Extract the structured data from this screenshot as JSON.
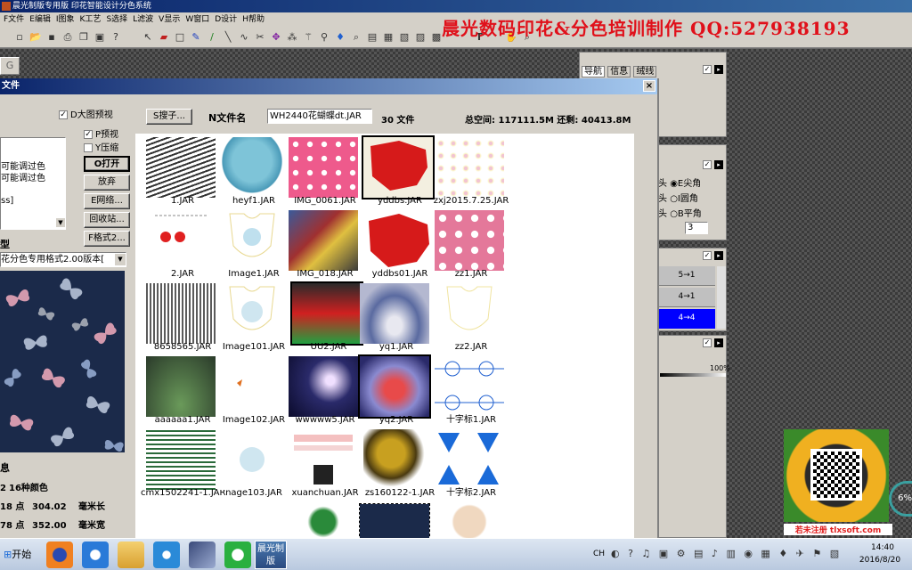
{
  "app": {
    "title": "晨光制版专用版 印花智能设计分色系统",
    "menu": [
      "F文件",
      "E编辑",
      "I图象",
      "K工艺",
      "S选择",
      "L滤波",
      "V显示",
      "W窗口",
      "D设计",
      "H帮助"
    ]
  },
  "banner": {
    "text": "晨光数码印花&分色培训制作 QQ:527938193"
  },
  "left_tab": {
    "label": "G"
  },
  "dialog": {
    "title": "文件",
    "checkboxes": {
      "big_preview": {
        "label": "D大图预视",
        "checked": "✓"
      },
      "p_preview": {
        "label": "P预视",
        "checked": "✓"
      },
      "y_compress": {
        "label": "Y压缩",
        "checked": ""
      }
    },
    "buttons": {
      "open": "O打开",
      "cancel": "放弃",
      "network": "E网络...",
      "recycle": "回收站...",
      "format": "F格式2..."
    },
    "info_lines": [
      "可能调过色",
      "可能调过色",
      "ss]"
    ],
    "type_label": "型",
    "format_select": "花分色专用格式2.00版本[",
    "search_button": "S搜子...",
    "filename_label": "N文件名",
    "filename_value": "WH2440花蝴蝶dt.JAR",
    "file_count": "30 文件",
    "space": "总空间: 117111.5M  还剩: 40413.8M",
    "info_header": "息",
    "info_rows": [
      {
        "a": "2",
        "b": "16种颜色",
        "c": ""
      },
      {
        "a": "18 点",
        "b": "304.02",
        "c": "毫米长"
      },
      {
        "a": "78 点",
        "b": "352.00",
        "c": "毫米宽"
      }
    ]
  },
  "files": [
    {
      "name": "1.JAR"
    },
    {
      "name": "heyf1.JAR"
    },
    {
      "name": "IMG_0061.JAR"
    },
    {
      "name": "yddbs.JAR"
    },
    {
      "name": "zxj2015.7.25.JAR"
    },
    {
      "name": "2.JAR"
    },
    {
      "name": "Image1.JAR"
    },
    {
      "name": "IMG_018.JAR"
    },
    {
      "name": "yddbs01.JAR"
    },
    {
      "name": "zz1.JAR"
    },
    {
      "name": "8658565.JAR"
    },
    {
      "name": "Image101.JAR"
    },
    {
      "name": "UU2.JAR"
    },
    {
      "name": "yq1.JAR"
    },
    {
      "name": "zz2.JAR"
    },
    {
      "name": "aaaaaa1.JAR"
    },
    {
      "name": "Image102.JAR"
    },
    {
      "name": "wwwww5.JAR"
    },
    {
      "name": "yq2.JAR"
    },
    {
      "name": "十字标1.JAR"
    },
    {
      "name": "cmx1502241-1.JAR"
    },
    {
      "name": "nage103.JAR"
    },
    {
      "name": "xuanchuan.JAR"
    },
    {
      "name": "zs160122-1.JAR"
    },
    {
      "name": "十字标2.JAR"
    }
  ],
  "right_panel": {
    "tabs": [
      "导航",
      "信息",
      "绒线"
    ],
    "radios": [
      {
        "pre": "头",
        "label": "E尖角",
        "checked": true
      },
      {
        "pre": "头",
        "label": "I圆角",
        "checked": false
      },
      {
        "pre": "头",
        "label": "B平角",
        "checked": false
      }
    ],
    "value_box": "3",
    "layers": [
      "5→1",
      "4→1",
      "4→4"
    ],
    "percent": "100%"
  },
  "watermark": {
    "caption": "若未注册 tlxsoft.com",
    "percent": "6%"
  },
  "taskbar": {
    "start": "开始",
    "active_app": "晨光制版",
    "tray": {
      "lang": "CH",
      "time": "14:40",
      "date": "2016/8/20"
    }
  },
  "colors": {
    "title_blue": "#0a246a",
    "banner_red": "#e0101a",
    "face": "#d4d0c8",
    "layer_selected": "#0000ff"
  }
}
